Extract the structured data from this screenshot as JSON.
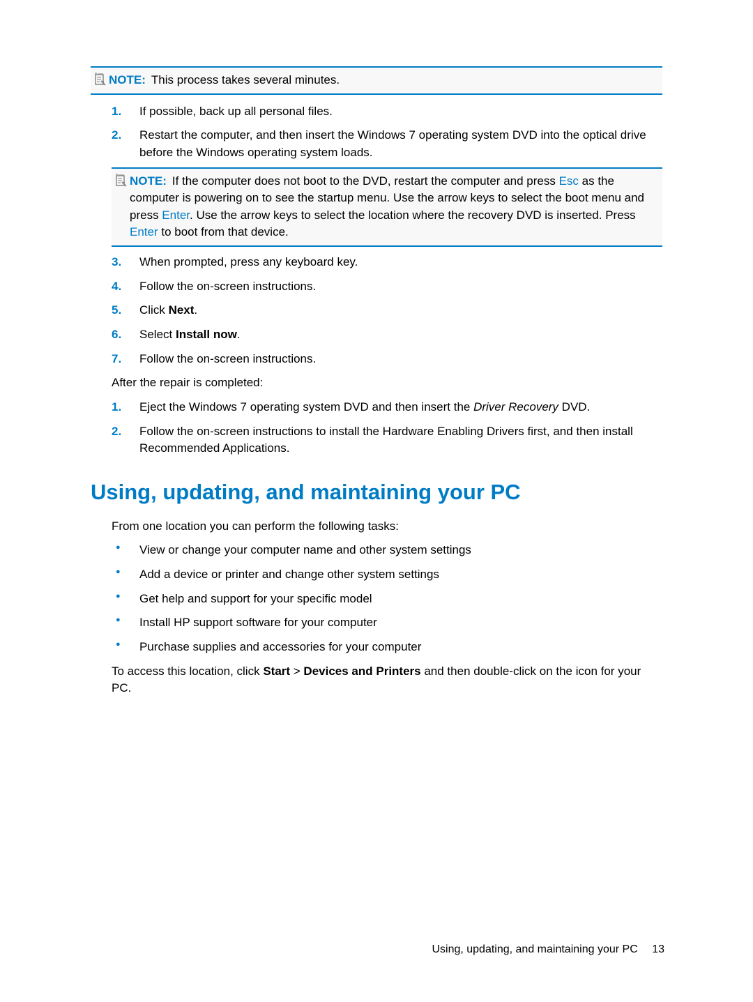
{
  "note1": {
    "label": "NOTE:",
    "text": "This process takes several minutes."
  },
  "list1": {
    "item1": "If possible, back up all personal files.",
    "item2": "Restart the computer, and then insert the Windows 7 operating system DVD into the optical drive before the Windows operating system loads.",
    "item3": "When prompted, press any keyboard key.",
    "item4": "Follow the on-screen instructions.",
    "item5_pre": "Click ",
    "item5_bold": "Next",
    "item5_post": ".",
    "item6_pre": "Select ",
    "item6_bold": "Install now",
    "item6_post": ".",
    "item7": "Follow the on-screen instructions.",
    "m1": "1.",
    "m2": "2.",
    "m3": "3.",
    "m4": "4.",
    "m5": "5.",
    "m6": "6.",
    "m7": "7."
  },
  "note2": {
    "label": "NOTE:",
    "pre": "If the computer does not boot to the DVD, restart the computer and press ",
    "esc": "Esc",
    "mid1": " as the computer is powering on to see the startup menu. Use the arrow keys to select the boot menu and press ",
    "enter1": "Enter",
    "mid2": ". Use the arrow keys to select the location where the recovery DVD is inserted. Press ",
    "enter2": "Enter",
    "post": " to boot from that device."
  },
  "after_repair": "After the repair is completed:",
  "list2": {
    "item1_pre": "Eject the Windows 7 operating system DVD and then insert the ",
    "item1_italic": "Driver Recovery",
    "item1_post": " DVD.",
    "item2": "Follow the on-screen instructions to install the Hardware Enabling Drivers first, and then install Recommended Applications.",
    "m1": "1.",
    "m2": "2."
  },
  "heading": "Using, updating, and maintaining your PC",
  "para1": "From one location you can perform the following tasks:",
  "bullets": {
    "b1": "View or change your computer name and other system settings",
    "b2": "Add a device or printer and change other system settings",
    "b3": "Get help and support for your specific model",
    "b4": "Install HP support software for your computer",
    "b5": "Purchase supplies and accessories for your computer"
  },
  "para2": {
    "pre": "To access this location, click ",
    "b1": "Start",
    "gt": " > ",
    "b2": "Devices and Printers",
    "post": " and then double-click on the icon for your PC."
  },
  "footer": {
    "text": "Using, updating, and maintaining your PC",
    "page": "13"
  }
}
